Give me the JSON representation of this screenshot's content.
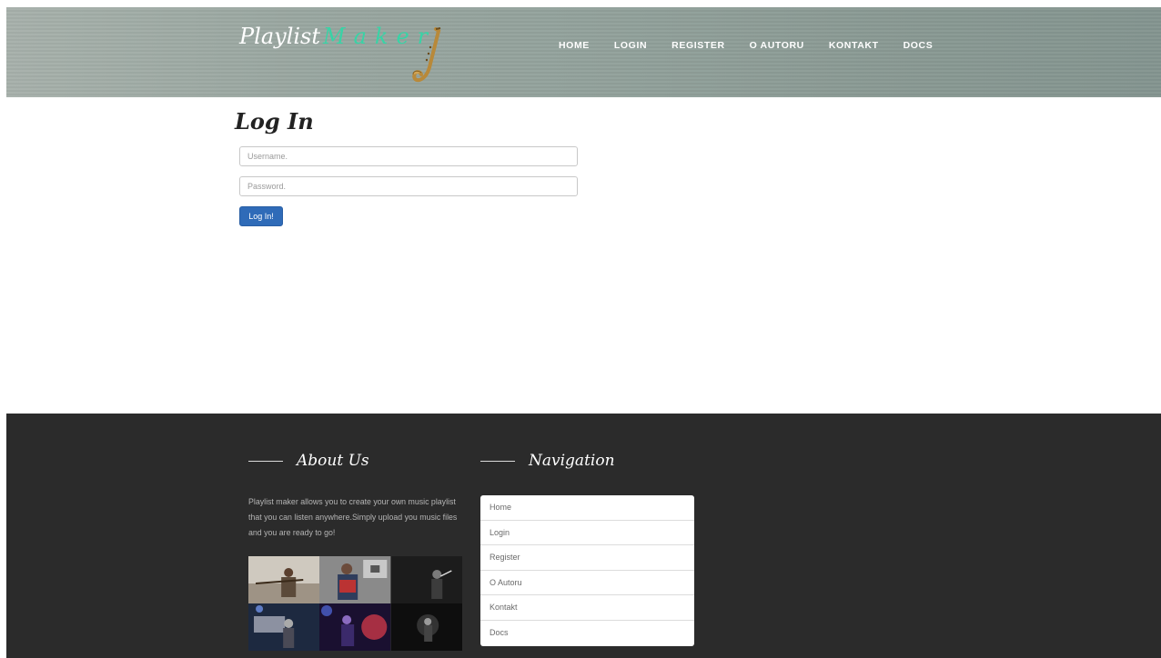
{
  "header": {
    "logo_main": "Playlist",
    "logo_accent": "Maker",
    "nav": [
      "HOME",
      "LOGIN",
      "REGISTER",
      "O AUTORU",
      "KONTAKT",
      "DOCS"
    ]
  },
  "login": {
    "title": "Log In",
    "username_placeholder": "Username.",
    "password_placeholder": "Password.",
    "submit_label": "Log In!"
  },
  "footer": {
    "about_title": "About Us",
    "about_text": "Playlist maker allows you to create your own music playlist that you can listen anywhere.Simply upload you music files and you are ready to go!",
    "nav_title": "Navigation",
    "nav_items": [
      "Home",
      "Login",
      "Register",
      "O Autoru",
      "Kontakt",
      "Docs"
    ]
  },
  "colors": {
    "accent": "#39d3a6",
    "button": "#2f6bb8",
    "footer_bg": "#2b2b2b"
  }
}
